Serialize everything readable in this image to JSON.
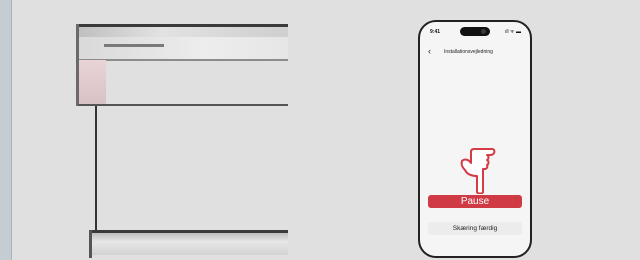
{
  "phone": {
    "status_time": "9:41",
    "status_icons": "ıll ᯤ ▬",
    "title": "Installationsvejledning",
    "back_icon": "chevron-left-icon",
    "pause_label": "Pause",
    "done_label": "Skæring færdig",
    "pointer_icon": "pointing-hand-icon"
  },
  "colors": {
    "accent": "#cf3a44",
    "secondary_button": "#ececec",
    "background": "#e0e0e0"
  }
}
